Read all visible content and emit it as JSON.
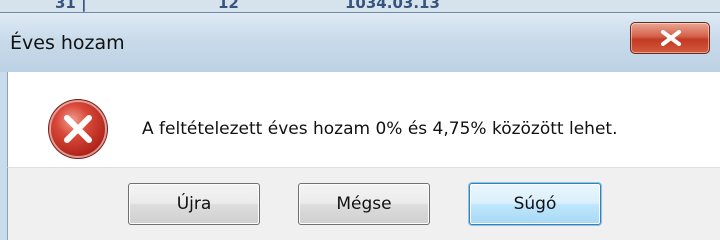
{
  "background": {
    "texts": [
      "31 |",
      "12",
      "1034.03.13"
    ]
  },
  "dialog": {
    "title": "Éves hozam",
    "close_icon": "close-icon",
    "icon": "error-icon",
    "message": "A feltételezett éves hozam 0% és 4,75% közözött lehet.",
    "buttons": {
      "retry": "Újra",
      "cancel": "Mégse",
      "help": "Súgó"
    },
    "colors": {
      "close_button": "#c23a21",
      "error_icon": "#d33a2c",
      "focused_button_border": "#3c7fb1"
    }
  }
}
